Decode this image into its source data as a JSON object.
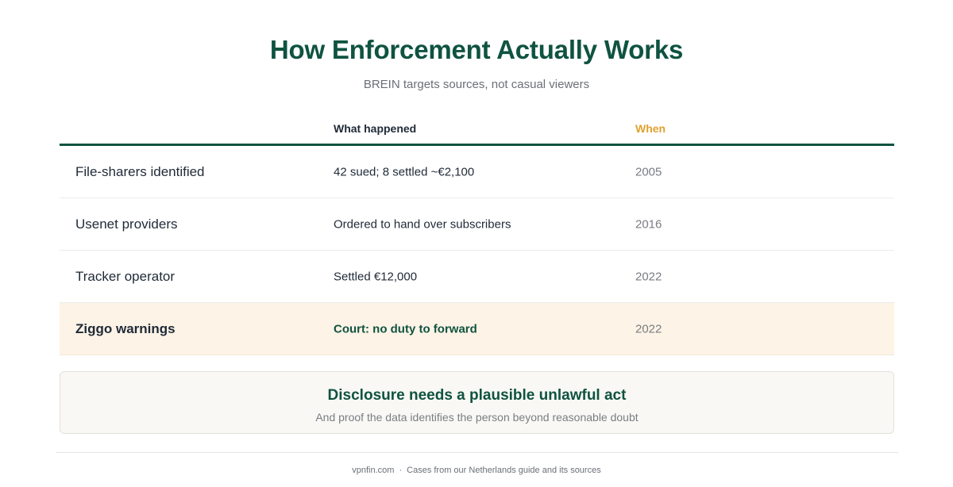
{
  "header": {
    "title": "How Enforcement Actually Works",
    "subtitle": "BREIN targets sources, not casual viewers"
  },
  "table": {
    "columns": [
      "",
      "What happened",
      "When"
    ],
    "rows": [
      {
        "subject": "File-sharers identified",
        "what": "42 sued; 8 settled ~€2,100",
        "when": "2005",
        "highlight": false
      },
      {
        "subject": "Usenet providers",
        "what": "Ordered to hand over subscribers",
        "when": "2016",
        "highlight": false
      },
      {
        "subject": "Tracker operator",
        "what": "Settled €12,000",
        "when": "2022",
        "highlight": false
      },
      {
        "subject": "Ziggo warnings",
        "what": "Court: no duty to forward",
        "when": "2022",
        "highlight": true
      }
    ]
  },
  "callout": {
    "title": "Disclosure needs a plausible unlawful act",
    "subtitle": "And proof the data identifies the person beyond reasonable doubt"
  },
  "footer": {
    "site": "vpnfin.com",
    "separator": "·",
    "note": "Cases from our Netherlands guide and its sources"
  },
  "colors": {
    "brand_green": "#0f5340",
    "accent_amber": "#e0a12e",
    "highlight_bg": "#fdf3e6"
  }
}
